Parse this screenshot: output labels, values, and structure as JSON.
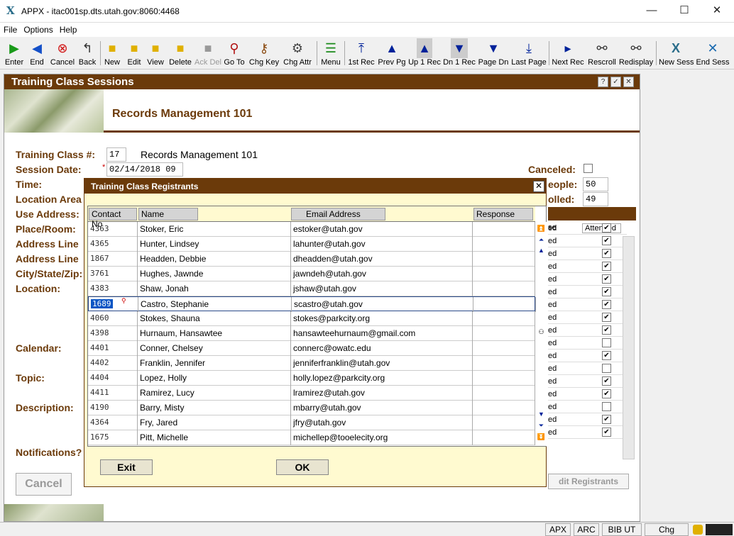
{
  "window": {
    "app_title": "APPX - itac001sp.dts.utah.gov:8060:4468",
    "logo": "X",
    "minimize": "—",
    "maximize": "☐",
    "close": "✕"
  },
  "menu": [
    "File",
    "Options",
    "Help"
  ],
  "toolbar": [
    {
      "label": "Enter",
      "icon": "play-icon"
    },
    {
      "label": "End",
      "icon": "back-arrow-icon"
    },
    {
      "label": "Cancel",
      "icon": "cancel-icon"
    },
    {
      "label": "Back",
      "icon": "back-icon"
    },
    {
      "label": "New",
      "icon": "new-folder-icon"
    },
    {
      "label": "Edit",
      "icon": "edit-folder-icon"
    },
    {
      "label": "View",
      "icon": "view-folder-icon"
    },
    {
      "label": "Delete",
      "icon": "delete-folder-icon"
    },
    {
      "label": "Ack Del",
      "icon": "ack-delete-icon",
      "disabled": true
    },
    {
      "label": "Go To",
      "icon": "magnifier-icon"
    },
    {
      "label": "Chg Key",
      "icon": "key-icon"
    },
    {
      "label": "Chg Attr",
      "icon": "change-attr-icon"
    },
    {
      "label": "Menu",
      "icon": "menu-icon"
    },
    {
      "label": "1st Rec",
      "icon": "first-record-icon"
    },
    {
      "label": "Prev Pg",
      "icon": "prev-page-icon"
    },
    {
      "label": "Up 1 Rec",
      "icon": "up-record-icon"
    },
    {
      "label": "Dn 1 Rec",
      "icon": "down-record-icon"
    },
    {
      "label": "Page Dn",
      "icon": "page-down-icon"
    },
    {
      "label": "Last Page",
      "icon": "last-page-icon"
    },
    {
      "label": "Next Rec",
      "icon": "next-record-icon"
    },
    {
      "label": "Rescroll",
      "icon": "rescroll-icon"
    },
    {
      "label": "Redisplay",
      "icon": "redisplay-icon"
    },
    {
      "label": "New Sess",
      "icon": "new-session-icon"
    },
    {
      "label": "End Sess",
      "icon": "end-session-icon"
    }
  ],
  "main": {
    "title": "Training Class Sessions",
    "header": "Records Management 101",
    "buttons": {
      "help": "?",
      "ok": "✓",
      "close": "✕"
    },
    "labels": {
      "training_class": "Training Class #:",
      "session_date": "Session Date:",
      "time": "Time:",
      "location_area": "Location Area",
      "use_address": "Use Address:",
      "place_room": "Place/Room:",
      "address_line1": "Address Line",
      "address_line2": "Address Line",
      "city_state_zip": "City/State/Zip:",
      "location": "Location:",
      "calendar": "Calendar:",
      "topic": "Topic:",
      "description": "Description:",
      "notifications": "Notifications?",
      "canceled": "Canceled:",
      "people": "eople:",
      "enrolled": "olled:"
    },
    "values": {
      "class_no": "17",
      "class_name": "Records Management 101",
      "required_mark": "*",
      "session_date": "02/14/2018 09",
      "people": "50",
      "enrolled": "49"
    },
    "cancel_button": "Cancel",
    "edit_registrants_button": "dit Registrants",
    "bg_grid": {
      "col_status": "se",
      "col_attended": "Attended",
      "rows": [
        {
          "status": "ed",
          "attended": true
        },
        {
          "status": "ed",
          "attended": true
        },
        {
          "status": "ed",
          "attended": true
        },
        {
          "status": "ed",
          "attended": true
        },
        {
          "status": "ed",
          "attended": true
        },
        {
          "status": "ed",
          "attended": true
        },
        {
          "status": "ed",
          "attended": true
        },
        {
          "status": "ed",
          "attended": true
        },
        {
          "status": "ed",
          "attended": true
        },
        {
          "status": "ed",
          "attended": false
        },
        {
          "status": "ed",
          "attended": true
        },
        {
          "status": "ed",
          "attended": false
        },
        {
          "status": "ed",
          "attended": true
        },
        {
          "status": "ed",
          "attended": true
        },
        {
          "status": "ed",
          "attended": false
        },
        {
          "status": "ed",
          "attended": true
        },
        {
          "status": "ed",
          "attended": true
        }
      ]
    }
  },
  "dialog": {
    "title": "Training Class Registrants",
    "close": "✕",
    "columns": [
      "Contact No",
      "Name",
      "Email Address",
      "Response"
    ],
    "rows": [
      {
        "contact": "4363",
        "name": "Stoker, Eric",
        "email": "estoker@utah.gov",
        "response": ""
      },
      {
        "contact": "4365",
        "name": "Hunter, Lindsey",
        "email": "lahunter@utah.gov",
        "response": ""
      },
      {
        "contact": "1867",
        "name": "Headden, Debbie",
        "email": "dheadden@utah.gov",
        "response": ""
      },
      {
        "contact": "3761",
        "name": "Hughes, Jawnde",
        "email": "jawndeh@utah.gov",
        "response": ""
      },
      {
        "contact": "4383",
        "name": "Shaw, Jonah",
        "email": "jshaw@utah.gov",
        "response": ""
      },
      {
        "contact": "1689",
        "name": "Castro, Stephanie",
        "email": "scastro@utah.gov",
        "response": "",
        "selected": true
      },
      {
        "contact": "4060",
        "name": "Stokes, Shauna",
        "email": "stokes@parkcity.org",
        "response": ""
      },
      {
        "contact": "4398",
        "name": "Hurnaum, Hansawtee",
        "email": "hansawteehurnaum@gmail.com",
        "response": ""
      },
      {
        "contact": "4401",
        "name": "Conner, Chelsey",
        "email": "connerc@owatc.edu",
        "response": ""
      },
      {
        "contact": "4402",
        "name": "Franklin, Jennifer",
        "email": "jenniferfranklin@utah.gov",
        "response": ""
      },
      {
        "contact": "4404",
        "name": "Lopez, Holly",
        "email": "holly.lopez@parkcity.org",
        "response": ""
      },
      {
        "contact": "4411",
        "name": "Ramirez, Lucy",
        "email": "lramirez@utah.gov",
        "response": ""
      },
      {
        "contact": "4190",
        "name": "Barry, Misty",
        "email": "mbarry@utah.gov",
        "response": ""
      },
      {
        "contact": "4364",
        "name": "Fry, Jared",
        "email": "jfry@utah.gov",
        "response": ""
      },
      {
        "contact": "1675",
        "name": "Pitt, Michelle",
        "email": "michellep@tooelecity.org",
        "response": ""
      }
    ],
    "exit_button": "Exit",
    "ok_button": "OK"
  },
  "statusbar": {
    "apx": "APX",
    "arc": "ARC",
    "bib": "BIB UT",
    "mode": "Chg"
  }
}
